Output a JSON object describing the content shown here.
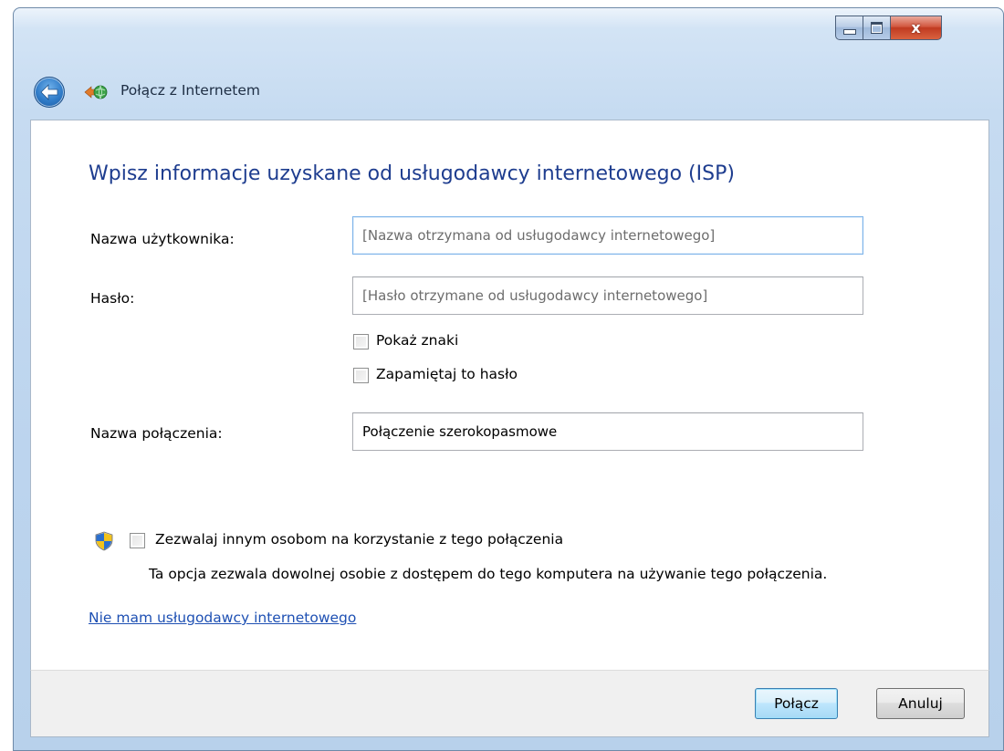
{
  "window": {
    "title": "Połącz z Internetem",
    "close_glyph": "x"
  },
  "form": {
    "heading": "Wpisz informacje uzyskane od usługodawcy internetowego (ISP)",
    "username": {
      "label": "Nazwa użytkownika:",
      "placeholder": "[Nazwa otrzymana od usługodawcy internetowego]",
      "value": ""
    },
    "password": {
      "label": "Hasło:",
      "placeholder": "[Hasło otrzymane od usługodawcy internetowego]",
      "value": ""
    },
    "show_chars": {
      "label": "Pokaż znaki",
      "checked": false
    },
    "remember_password": {
      "label": "Zapamiętaj to hasło",
      "checked": false
    },
    "connection_name": {
      "label": "Nazwa połączenia:",
      "value": "Połączenie szerokopasmowe"
    },
    "allow_others": {
      "label": "Zezwalaj innym osobom na korzystanie z tego połączenia",
      "checked": false,
      "description": "Ta opcja zezwala dowolnej osobie z dostępem do tego komputera na używanie tego połączenia."
    },
    "no_isp_link": "Nie mam usługodawcy internetowego"
  },
  "footer": {
    "connect_label": "Połącz",
    "cancel_label": "Anuluj"
  },
  "icons": {
    "back": "back-arrow-icon",
    "app": "network-globe-icon",
    "uac": "uac-shield-icon"
  },
  "colors": {
    "heading": "#1e3d8f",
    "link": "#1e50b3",
    "accent": "#2f7bc8"
  }
}
